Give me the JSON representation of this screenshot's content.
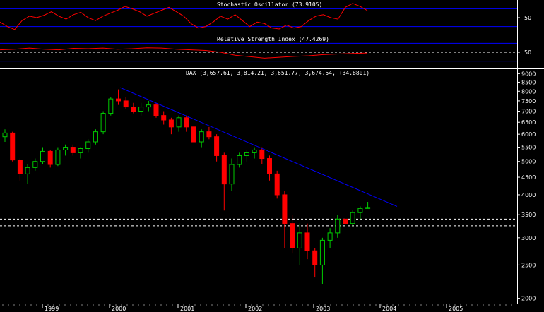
{
  "chart_data": [
    {
      "type": "line",
      "title": "Stochastic Oscillator (73.9105)",
      "ylim": [
        0,
        100
      ],
      "ytick_labels": [
        "50"
      ],
      "ytick_values": [
        50
      ],
      "reference_lines": [
        80,
        20
      ],
      "reference_line_color": "#0000ff",
      "line_color": "#ff0000",
      "x": [
        0,
        0.02,
        0.04,
        0.06,
        0.08,
        0.1,
        0.12,
        0.14,
        0.16,
        0.18,
        0.2,
        0.22,
        0.24,
        0.26,
        0.28,
        0.3,
        0.32,
        0.34,
        0.36,
        0.38,
        0.4,
        0.42,
        0.44,
        0.46,
        0.48,
        0.5,
        0.52,
        0.54,
        0.56,
        0.58,
        0.6,
        0.62,
        0.64,
        0.66,
        0.68,
        0.7,
        0.72,
        0.74,
        0.76,
        0.78,
        0.8,
        0.82,
        0.84,
        0.86,
        0.88,
        0.9,
        0.92,
        0.94,
        0.96,
        0.98,
        1.0
      ],
      "values": [
        35,
        20,
        10,
        40,
        55,
        50,
        58,
        70,
        55,
        45,
        60,
        68,
        50,
        40,
        55,
        65,
        75,
        88,
        80,
        70,
        55,
        65,
        75,
        85,
        70,
        55,
        30,
        15,
        20,
        35,
        55,
        45,
        60,
        40,
        20,
        35,
        30,
        15,
        12,
        25,
        15,
        20,
        40,
        55,
        60,
        50,
        45,
        85,
        98,
        88,
        73.9
      ]
    },
    {
      "type": "line",
      "title": "Relative Strength Index (47.4269)",
      "ylim": [
        0,
        100
      ],
      "ytick_labels": [
        "50"
      ],
      "ytick_values": [
        50
      ],
      "reference_lines": [
        80,
        20
      ],
      "dashed_lines": [
        50
      ],
      "reference_line_color": "#0000ff",
      "line_color": "#ff0000",
      "x": [
        0,
        0.04,
        0.08,
        0.12,
        0.16,
        0.2,
        0.24,
        0.28,
        0.32,
        0.36,
        0.4,
        0.44,
        0.48,
        0.52,
        0.56,
        0.6,
        0.64,
        0.68,
        0.72,
        0.76,
        0.8,
        0.84,
        0.88,
        0.92,
        0.96,
        1.0
      ],
      "values": [
        58,
        60,
        64,
        60,
        58,
        63,
        62,
        64,
        60,
        62,
        65,
        64,
        60,
        58,
        56,
        50,
        40,
        35,
        30,
        33,
        36,
        38,
        42,
        44,
        46,
        47.4
      ]
    },
    {
      "type": "candlestick",
      "title": "DAX (3,657.61, 3,814.21, 3,651.77, 3,674.54, +34.8801)",
      "yscale": "log",
      "ylim": [
        1950,
        9100
      ],
      "ytick_labels": [
        "2000",
        "2500",
        "3000",
        "3500",
        "4000",
        "4500",
        "5000",
        "5500",
        "6000",
        "6500",
        "7000",
        "7500",
        "8000",
        "8500",
        "9000"
      ],
      "ytick_values": [
        2000,
        2500,
        3000,
        3500,
        4000,
        4500,
        5000,
        5500,
        6000,
        6500,
        7000,
        7500,
        8000,
        8500,
        9000
      ],
      "xtick_labels": [
        "1999",
        "2000",
        "2001",
        "2002",
        "2003",
        "2004",
        "2005"
      ],
      "up_color": "#00cc00",
      "down_color": "#ff0000",
      "trendline": {
        "from": [
          0,
          8200
        ],
        "to": [
          1.0,
          3700
        ],
        "color": "#0000ff"
      },
      "dashed_levels": [
        3400,
        3250
      ],
      "candles": [
        [
          5900,
          6200,
          5700,
          6050
        ],
        [
          6050,
          6100,
          5000,
          5050
        ],
        [
          5050,
          5100,
          4400,
          4600
        ],
        [
          4600,
          4900,
          4300,
          4800
        ],
        [
          4800,
          5100,
          4700,
          5000
        ],
        [
          5000,
          5500,
          4900,
          5350
        ],
        [
          5350,
          5400,
          4800,
          4900
        ],
        [
          4900,
          5500,
          4850,
          5400
        ],
        [
          5400,
          5600,
          5200,
          5500
        ],
        [
          5500,
          5600,
          5200,
          5300
        ],
        [
          5300,
          5500,
          5100,
          5450
        ],
        [
          5450,
          5800,
          5300,
          5700
        ],
        [
          5700,
          6200,
          5600,
          6100
        ],
        [
          6100,
          7000,
          6000,
          6900
        ],
        [
          6900,
          7700,
          6800,
          7600
        ],
        [
          7600,
          8100,
          7300,
          7500
        ],
        [
          7500,
          7700,
          7100,
          7200
        ],
        [
          7200,
          7400,
          6900,
          7000
        ],
        [
          7000,
          7400,
          6800,
          7200
        ],
        [
          7200,
          7500,
          7000,
          7300
        ],
        [
          7300,
          7400,
          6700,
          6800
        ],
        [
          6800,
          7000,
          6400,
          6600
        ],
        [
          6600,
          6700,
          6000,
          6300
        ],
        [
          6300,
          6800,
          6100,
          6700
        ],
        [
          6700,
          6800,
          6100,
          6300
        ],
        [
          6300,
          6500,
          5400,
          5700
        ],
        [
          5700,
          6200,
          5500,
          6100
        ],
        [
          6100,
          6300,
          5800,
          5900
        ],
        [
          5900,
          6000,
          5000,
          5200
        ],
        [
          5200,
          5300,
          3600,
          4300
        ],
        [
          4300,
          5100,
          4100,
          4900
        ],
        [
          4900,
          5300,
          4800,
          5200
        ],
        [
          5200,
          5400,
          5000,
          5300
        ],
        [
          5300,
          5500,
          5100,
          5400
        ],
        [
          5400,
          5500,
          4900,
          5100
        ],
        [
          5100,
          5200,
          4400,
          4600
        ],
        [
          4600,
          4700,
          3900,
          4000
        ],
        [
          4000,
          4100,
          2800,
          3300
        ],
        [
          3300,
          3500,
          2700,
          2800
        ],
        [
          2800,
          3300,
          2500,
          3100
        ],
        [
          3100,
          3300,
          2600,
          2750
        ],
        [
          2750,
          2800,
          2300,
          2500
        ],
        [
          2500,
          3000,
          2200,
          2950
        ],
        [
          2950,
          3200,
          2800,
          3100
        ],
        [
          3100,
          3500,
          3000,
          3400
        ],
        [
          3400,
          3500,
          3200,
          3300
        ],
        [
          3300,
          3600,
          3250,
          3550
        ],
        [
          3550,
          3700,
          3400,
          3650
        ],
        [
          3650,
          3814,
          3651,
          3675
        ]
      ]
    }
  ]
}
